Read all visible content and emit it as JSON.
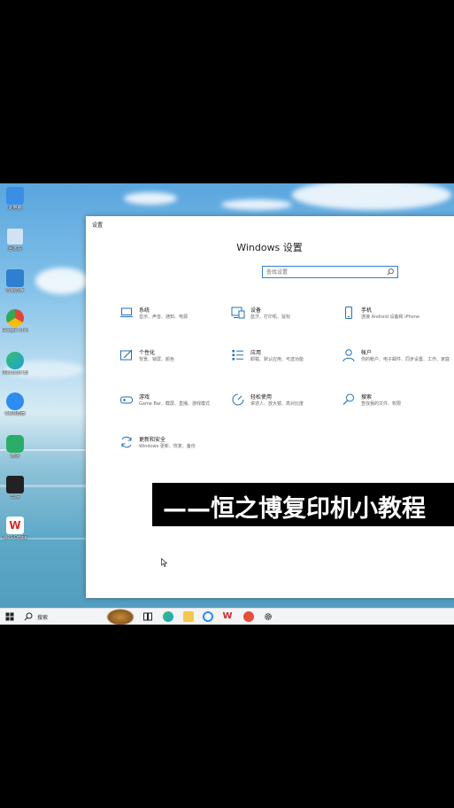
{
  "desktop_icons": [
    {
      "label": "此电脑",
      "color": "#3a8ee6"
    },
    {
      "label": "回收站",
      "color": "#6fb0e0"
    },
    {
      "label": "控制面板",
      "color": "#2f7fd0"
    },
    {
      "label": "Google Chrome",
      "color": "#e94235"
    },
    {
      "label": "Microsoft Edge",
      "color": "#1fa0d8"
    },
    {
      "label": "QQ浏览器",
      "color": "#2d8cf0"
    },
    {
      "label": "微信",
      "color": "#2aae67"
    },
    {
      "label": "剪映",
      "color": "#222222"
    },
    {
      "label": "WPS Office",
      "color": "#d9262c"
    }
  ],
  "window": {
    "title": "设置",
    "heading": "Windows 设置",
    "search_placeholder": "查找设置"
  },
  "settings_tiles": [
    {
      "name": "系统",
      "desc": "显示、声音、通知、电源",
      "icon": "laptop-icon"
    },
    {
      "name": "设备",
      "desc": "蓝牙、打印机、鼠标",
      "icon": "devices-icon"
    },
    {
      "name": "手机",
      "desc": "连接 Android 设备和 iPhone",
      "icon": "phone-icon"
    },
    {
      "name": "个性化",
      "desc": "背景、锁屏、颜色",
      "icon": "personalization-icon"
    },
    {
      "name": "应用",
      "desc": "卸载、默认应用、可选功能",
      "icon": "apps-icon"
    },
    {
      "name": "帐户",
      "desc": "你的帐户、电子邮件、同步设置、工作、家庭",
      "icon": "account-icon"
    },
    {
      "name": "游戏",
      "desc": "Game Bar、截屏、直播、游戏模式",
      "icon": "gaming-icon"
    },
    {
      "name": "轻松使用",
      "desc": "讲述人、放大镜、高对比度",
      "icon": "ease-of-access-icon"
    },
    {
      "name": "搜索",
      "desc": "查找我的文件、权限",
      "icon": "search-icon"
    },
    {
      "name": "更新和安全",
      "desc": "Windows 更新、恢复、备份",
      "icon": "update-icon"
    }
  ],
  "taskbar": {
    "search_label": "搜索",
    "items": [
      "task-view-icon",
      "edge-icon",
      "explorer-icon",
      "browser-icon",
      "wps-icon",
      "record-icon",
      "settings-gear-icon"
    ]
  },
  "caption": "——恒之博复印机小教程",
  "colors": {
    "accent": "#2f7fd0",
    "icon_blue": "#1f6fb8"
  }
}
